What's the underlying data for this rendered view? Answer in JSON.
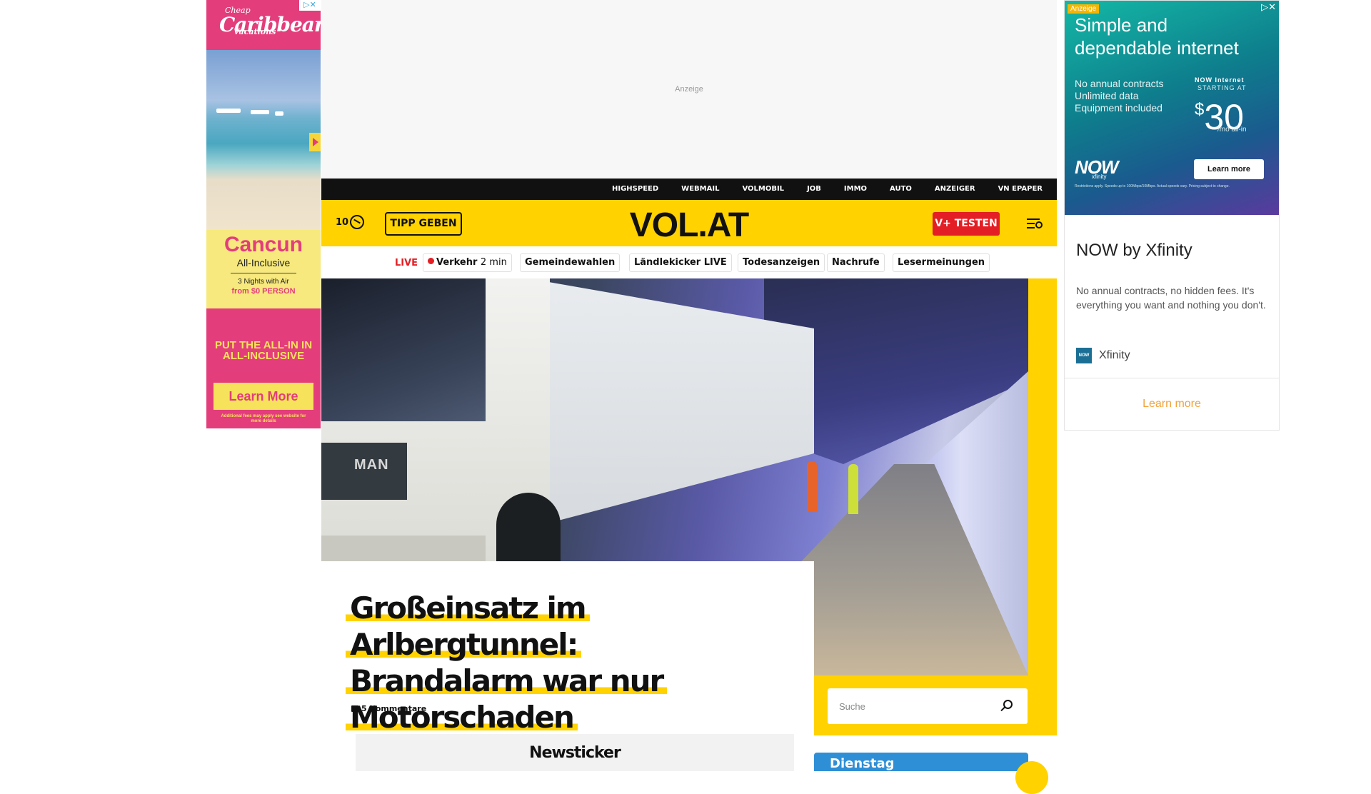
{
  "left_ad": {
    "brand_line1": "Cheap",
    "brand_line2": "Caribbean",
    "brand_line3": "Vacations",
    "destination": "Cancun",
    "package": "All-Inclusive",
    "nights": "3 Nights with Air",
    "price_from": "from $0 PERSON",
    "tagline": "PUT THE ALL-IN IN ALL-INCLUSIVE",
    "cta": "Learn More",
    "fine_print": "Additional fees may apply see website for more details",
    "adchoices": "▷✕",
    "colors": {
      "pink": "#e33d7b",
      "yellow": "#f6e35b"
    }
  },
  "top_ad": {
    "label": "Anzeige"
  },
  "right_ad": {
    "badge": "Anzeige",
    "headline": "Simple and dependable internet",
    "features": [
      "No annual contracts",
      "Unlimited data",
      "Equipment included"
    ],
    "offer_name": "NOW Internet",
    "offer_starting": "STARTING AT",
    "price": "30",
    "price_currency": "$",
    "price_unit": "/mo all-in",
    "brand_logo": "NOW",
    "brand_sub": "xfinity",
    "banner_cta": "Learn more",
    "fine_print": "Restrictions apply. Speeds up to 100Mbps/10Mbps. Actual speeds vary. Pricing subject to change.",
    "closers": "▷✕",
    "title": "NOW by Xfinity",
    "description": "No annual contracts, no hidden fees. It's everything you want and nothing you don't.",
    "advertiser_logo": "NOW",
    "advertiser": "Xfinity",
    "learn_more": "Learn more"
  },
  "topbar": {
    "links": [
      "HIGHSPEED",
      "WEBMAIL",
      "VOLMOBIL",
      "JOB",
      "IMMO",
      "AUTO",
      "ANZEIGER",
      "VN EPAPER"
    ]
  },
  "header": {
    "weather_value": "10",
    "tipp_label": "TIPP GEBEN",
    "logo": "VOL.AT",
    "vplus_label": "V+ TESTEN",
    "brand_yellow": "#ffd200",
    "accent_red": "#e31e24"
  },
  "quicknav": {
    "live_label": "LIVE",
    "verkehr": {
      "label": "Verkehr",
      "time": "2 min"
    },
    "items": [
      "Gemeindewahlen",
      "Ländlekicker LIVE",
      "Todesanzeigen",
      "Nachrufe",
      "Lesermeinungen"
    ]
  },
  "hero": {
    "image_subject": "truck-in-tunnel",
    "truck_brand": "MAN"
  },
  "article": {
    "title_lines": [
      "Großeinsatz im Arlbergtunnel:",
      "Brandalarm war nur",
      "Motorschaden"
    ],
    "comments": "5 Kommentare"
  },
  "newsticker": {
    "label": "Newsticker"
  },
  "search": {
    "placeholder": "Suche"
  },
  "day_card": {
    "label": "Dienstag"
  }
}
